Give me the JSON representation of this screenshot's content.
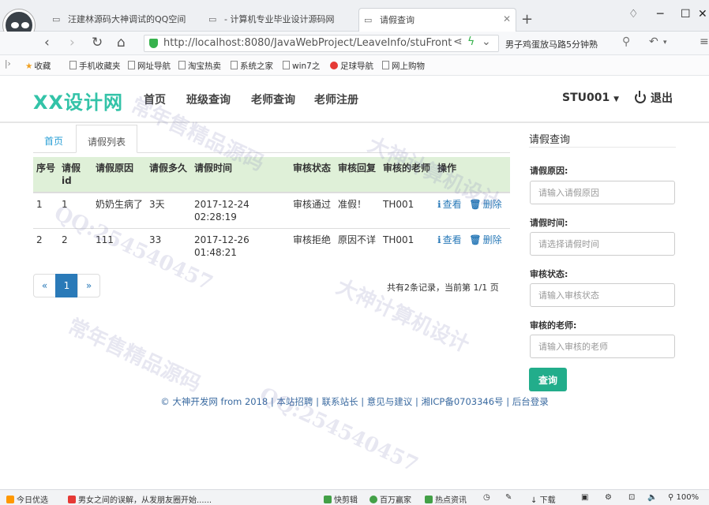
{
  "browser": {
    "tabs": [
      {
        "label": "汪建林源码大神调试的QQ空间"
      },
      {
        "label": "- 计算机专业毕业设计源码网"
      },
      {
        "label": "请假查询"
      }
    ],
    "url": "http://localhost:8080/JavaWebProject/LeaveInfo/stuFront",
    "news_text": "男子鸡蛋放马路5分钟熟",
    "bookmarks": [
      "收藏",
      "手机收藏夹",
      "网址导航",
      "淘宝热卖",
      "系统之家",
      "win7之",
      "足球导航",
      "网上购物"
    ]
  },
  "site": {
    "logo": "XX设计网",
    "nav": [
      "首页",
      "班级查询",
      "老师查询",
      "老师注册"
    ],
    "user": "STU001",
    "logout": "退出"
  },
  "content_tabs": {
    "home": "首页",
    "active": "请假列表"
  },
  "table": {
    "headers": [
      "序号",
      "请假id",
      "请假原因",
      "请假多久",
      "请假时间",
      "审核状态",
      "审核回复",
      "审核的老师",
      "操作"
    ],
    "rows": [
      {
        "index": "1",
        "id": "1",
        "reason": "奶奶生病了",
        "duration": "3天",
        "time": "2017-12-24 02:28:19",
        "status": "审核通过",
        "reply": "准假！",
        "teacher": "TH001"
      },
      {
        "index": "2",
        "id": "2",
        "reason": "111",
        "duration": "33",
        "time": "2017-12-26 01:48:21",
        "status": "审核拒绝",
        "reply": "原因不详",
        "teacher": "TH001"
      }
    ],
    "view_label": "查看",
    "delete_label": "删除"
  },
  "pagination": {
    "prev": "«",
    "current": "1",
    "next": "»",
    "info": "共有2条记录，当前第 1/1 页"
  },
  "search_panel": {
    "title": "请假查询",
    "reason_label": "请假原因:",
    "reason_placeholder": "请输入请假原因",
    "time_label": "请假时间:",
    "time_placeholder": "请选择请假时间",
    "status_label": "审核状态:",
    "status_placeholder": "请输入审核状态",
    "teacher_label": "审核的老师:",
    "teacher_placeholder": "请输入审核的老师",
    "query_button": "查询"
  },
  "footer": "© 大神开发网 from 2018 | 本站招聘 | 联系站长 | 意见与建议 | 湘ICP备0703346号 | 后台登录",
  "statusbar": {
    "left1": "今日优选",
    "left2": "男女之间的误解，从发朋友圈开始......",
    "items": [
      "快剪辑",
      "百万赢家",
      "热点资讯",
      "下载",
      "100%"
    ]
  },
  "watermarks": [
    "常年售精品源码",
    "大神计算机设计",
    "QQ:254540457"
  ]
}
